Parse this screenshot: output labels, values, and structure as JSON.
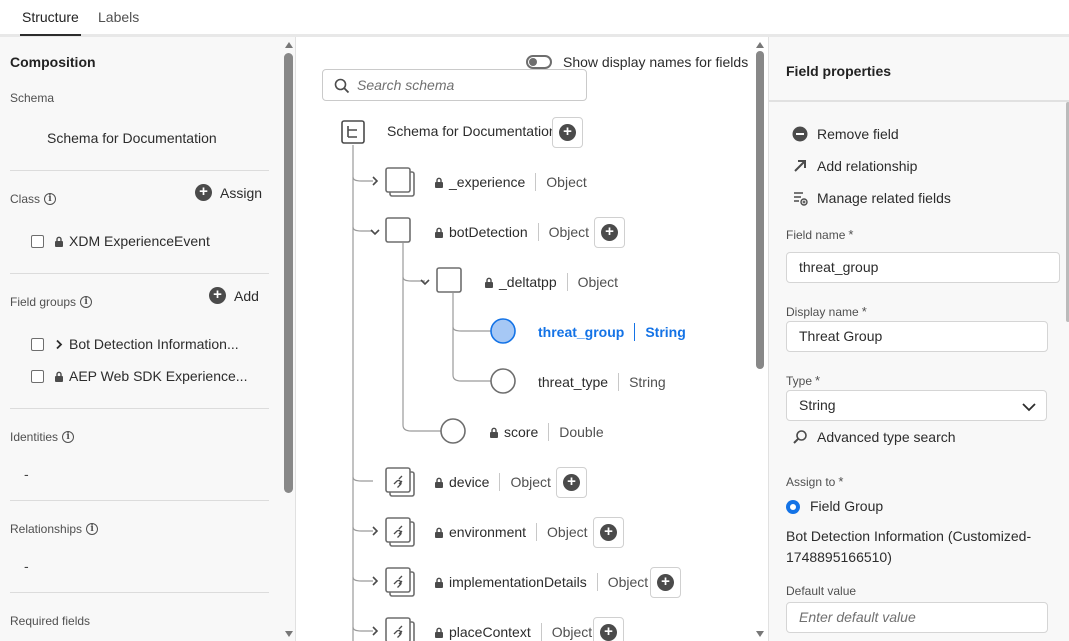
{
  "tabs": [
    {
      "label": "Structure",
      "active": true
    },
    {
      "label": "Labels",
      "active": false
    }
  ],
  "composition": {
    "title": "Composition",
    "schema_label": "Schema",
    "schema_name": "Schema for Documentation",
    "class_label": "Class",
    "assign_label": "Assign",
    "class_item": "XDM ExperienceEvent",
    "field_groups_label": "Field groups",
    "add_label": "Add",
    "field_groups": [
      "Bot Detection Information...",
      "AEP Web SDK Experience..."
    ],
    "identities_label": "Identities",
    "identities_value": "-",
    "relationships_label": "Relationships",
    "relationships_value": "-",
    "required_fields_label": "Required fields"
  },
  "tree": {
    "show_display_names": "Show display names for fields",
    "search_placeholder": "Search schema",
    "root": "Schema for Documentation",
    "nodes": [
      {
        "name": "_experience",
        "type": "Object"
      },
      {
        "name": "botDetection",
        "type": "Object"
      },
      {
        "name": "_deltatpp",
        "type": "Object"
      },
      {
        "name": "threat_group",
        "type": "String"
      },
      {
        "name": "threat_type",
        "type": "String"
      },
      {
        "name": "score",
        "type": "Double"
      },
      {
        "name": "device",
        "type": "Object"
      },
      {
        "name": "environment",
        "type": "Object"
      },
      {
        "name": "implementationDetails",
        "type": "Object"
      },
      {
        "name": "placeContext",
        "type": "Object"
      }
    ]
  },
  "field_properties": {
    "title": "Field properties",
    "remove_field": "Remove field",
    "add_relationship": "Add relationship",
    "manage_related": "Manage related fields",
    "field_name_label": "Field name",
    "field_name_value": "threat_group",
    "display_name_label": "Display name",
    "display_name_value": "Threat Group",
    "type_label": "Type",
    "type_value": "String",
    "advanced_type_search": "Advanced type search",
    "assign_to_label": "Assign to",
    "assign_option": "Field Group",
    "assign_target": "Bot Detection Information (Customized-1748895166510)",
    "default_value_label": "Default value",
    "default_value_placeholder": "Enter default value",
    "required_mark": "*"
  },
  "colors": {
    "accent": "#1473e6",
    "panel_bg": "#f8f8f8",
    "selected_node_fill": "#a6c8f5"
  }
}
